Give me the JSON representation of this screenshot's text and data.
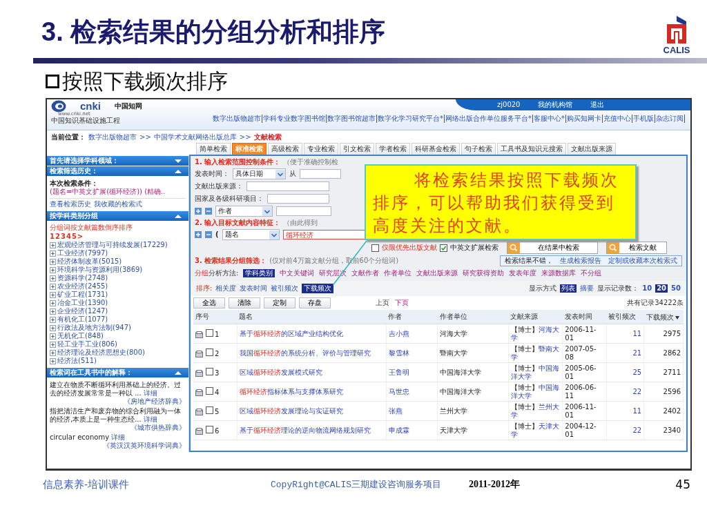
{
  "slide": {
    "title": "3. 检索结果的分组分析和排序",
    "logo_text": "CALIS",
    "subtitle": "按照下载频次排序"
  },
  "screen": {
    "header": {
      "logo": {
        "mark": "cnki",
        "name": "中国知网",
        "url": "www.cnki.net",
        "tagline": "中国知识基础设施工程"
      },
      "user_links": [
        "zj0020",
        "我的机构馆",
        "退出"
      ],
      "nav_links": [
        "数字出版物超市",
        "学科专业数字图书馆",
        "数字图书馆超市",
        "数字化学习研究平台*",
        "网络出版合作单位服务平台*",
        "客服中心*",
        "购买知网卡",
        "充值中心",
        "手机版",
        "杂志订阅"
      ]
    },
    "breadcrumb": {
      "label": "当前位置：",
      "items": [
        {
          "kind": "link",
          "text": "数字出版物超市"
        },
        {
          "kind": "separator",
          "text": ">>"
        },
        {
          "kind": "link",
          "text": "中国学术文献网络出版总库"
        },
        {
          "kind": "separator",
          "text": ">>"
        },
        {
          "kind": "current",
          "text": "文献检索"
        }
      ]
    },
    "tabs": [
      {
        "label": "简单检索",
        "selected": false
      },
      {
        "label": "标准检索",
        "selected": true
      },
      {
        "label": "高级检索",
        "selected": false
      },
      {
        "label": "专业检索",
        "selected": false
      },
      {
        "label": "引文检索",
        "selected": false
      },
      {
        "label": "学者检索",
        "selected": false
      },
      {
        "label": "科研基金检索",
        "selected": false
      },
      {
        "label": "句子检索",
        "selected": false
      },
      {
        "label": "工具书及知识元搜索",
        "selected": false
      },
      {
        "label": "文献出版来源",
        "selected": false
      }
    ],
    "sidebar": {
      "subject_panel": {
        "title": "首先请选择学科领域：",
        "expanded": false
      },
      "history_panel": {
        "title": "检索筛选历史：",
        "expanded": true,
        "condition_label": "本次检索条件：",
        "condition": "(题名=中英文扩展(循环经济)) (精确..",
        "links": [
          "查看检索历史",
          "我收藏的检索式"
        ]
      },
      "group_panel": {
        "title": "按学科类别分组",
        "expanded": true,
        "order_note": "分组词按文献篇数倒序排序",
        "pages": [
          "1",
          "2",
          "3",
          "4",
          "5",
          ">"
        ],
        "items": [
          {
            "label": "宏观经济管理与可持续发展(17229)",
            "expanded": false
          },
          {
            "label": "工业经济(7997)",
            "expanded": false
          },
          {
            "label": "经济体制改革(5015)",
            "expanded": false
          },
          {
            "label": "环境科学与资源利用(3869)",
            "expanded": false
          },
          {
            "label": "资源科学(2748)",
            "expanded": false
          },
          {
            "label": "农业经济(2455)",
            "expanded": false
          },
          {
            "label": "矿业工程(1731)",
            "expanded": false
          },
          {
            "label": "冶金工业(1390)",
            "expanded": false
          },
          {
            "label": "企业经济(1247)",
            "expanded": false
          },
          {
            "label": "有机化工(1077)",
            "expanded": false
          },
          {
            "label": "行政法及地方法制(947)",
            "expanded": false
          },
          {
            "label": "无机化工(848)",
            "expanded": false
          },
          {
            "label": "轻工业手工业(806)",
            "expanded": false
          },
          {
            "label": "经济理论及经济思想史(800)",
            "expanded": false
          },
          {
            "label": "经济法(511)",
            "expanded": false
          }
        ]
      },
      "dictionary_panel": {
        "title": "检索词在工具书中的解释：",
        "expanded": true,
        "entries": [
          {
            "text": "建立在物质不断循环利用基础上的经济。过去的经济发展常常是一种以 ...",
            "link": "详细",
            "source": "《房地产经济辞典》"
          },
          {
            "text": "指把清洁生产和废弃物的综合利用融为一体的经济,本质上是一种生态经...",
            "link": "详细",
            "source": "《城市供热辞典》"
          },
          {
            "text": "circular economy",
            "link": "详细",
            "source": "《英汉汉英环境科学词典》"
          }
        ]
      }
    },
    "search_form": {
      "step1": {
        "heading": "1. 输入检索范围控制条件：",
        "note": "（便于准确控制检"
      },
      "date_row": {
        "label": "发表时间：",
        "select": "具体日期",
        "from_label": "从"
      },
      "source_row": {
        "label": "文献出版来源："
      },
      "project_row": {
        "label": "国家及各级科研项目："
      },
      "author_row": {
        "select": "作者"
      },
      "step2": {
        "heading": "2. 输入目标文献内容特征：",
        "note": "（由此得到"
      },
      "content_row": {
        "paren": "(",
        "select": "题名",
        "value": "循环经济"
      },
      "options": [
        {
          "label": "仅限优先出版文献",
          "checked": false
        },
        {
          "label": "中英文扩展检索",
          "checked": true
        }
      ],
      "buttons": [
        "在结果中检索",
        "检索文献"
      ]
    },
    "grouping": {
      "heading": "3. 检索结果分组筛选：",
      "note": "(仅对前4万篇文献分组，取前60个分组词)",
      "feedback": {
        "text": "检索结果不错，",
        "links": [
          "生成检索报告",
          "定制或收藏本次检索式"
        ]
      },
      "method_label": {
        "highlight": "分组",
        "rest": "分析方法:"
      },
      "methods": [
        {
          "label": "学科类别",
          "selected": true
        },
        {
          "label": "中文关键词",
          "selected": false
        },
        {
          "label": "研究层次",
          "selected": false
        },
        {
          "label": "文献作者",
          "selected": false
        },
        {
          "label": "作者单位",
          "selected": false
        },
        {
          "label": "文献出版来源",
          "selected": false
        },
        {
          "label": "研究获得资助",
          "selected": false
        },
        {
          "label": "发表年度",
          "selected": false
        },
        {
          "label": "来源数据库",
          "selected": false
        },
        {
          "label": "不分组",
          "selected": false
        }
      ]
    },
    "sorting": {
      "label": "排序:",
      "options": [
        {
          "label": "相关度",
          "selected": false
        },
        {
          "label": "发表时间",
          "selected": false
        },
        {
          "label": "被引频次",
          "selected": false
        },
        {
          "label": "下载频次",
          "selected": true
        }
      ]
    },
    "display": {
      "label": "显示方式",
      "modes": [
        {
          "label": "列表",
          "selected": true
        },
        {
          "label": "摘要",
          "selected": false
        }
      ],
      "count_label": "显示记录数：",
      "counts": [
        {
          "label": "10",
          "selected": false
        },
        {
          "label": "20",
          "selected": true
        },
        {
          "label": "50",
          "selected": false
        }
      ]
    },
    "actions": [
      "全选",
      "清除",
      "定制",
      "存盘"
    ],
    "pager": [
      {
        "label": "上页",
        "disabled": true
      },
      {
        "label": "下页",
        "disabled": false
      }
    ],
    "total": "共有记录34222条",
    "results": {
      "columns": [
        {
          "label": "序号",
          "sorted": false
        },
        {
          "label": "题名",
          "sorted": false
        },
        {
          "label": "作者",
          "sorted": false
        },
        {
          "label": "作者单位",
          "sorted": false
        },
        {
          "label": "文献来源",
          "sorted": false
        },
        {
          "label": "发表时间",
          "sorted": false
        },
        {
          "label": "被引频次",
          "sorted": false
        },
        {
          "label": "下载频次",
          "sorted": true
        }
      ],
      "rows": [
        {
          "number": "1",
          "checked": false,
          "title": {
            "before": "基于",
            "keyword": "循环经济",
            "after": "的区域产业结构优化"
          },
          "author": "吉小燕",
          "unit": "河海大学",
          "source": {
            "type": "【博士】",
            "name": "河海大学"
          },
          "date": "2006-11-01",
          "cited": "11",
          "downloads": "2975"
        },
        {
          "number": "2",
          "checked": false,
          "title": {
            "before": "我国",
            "keyword": "循环经济",
            "after": "的系统分析、评价与管理研究"
          },
          "author": "黎雪林",
          "unit": "暨南大学",
          "source": {
            "type": "【博士】",
            "name": "暨南大学"
          },
          "date": "2007-05-08",
          "cited": "21",
          "downloads": "2862"
        },
        {
          "number": "3",
          "checked": false,
          "title": {
            "before": "区域",
            "keyword": "循环经济",
            "after": "发展模式研究"
          },
          "author": "王鲁明",
          "unit": "中国海洋大学",
          "source": {
            "type": "【博士】",
            "name": "中国海洋大学"
          },
          "date": "2005-06-01",
          "cited": "25",
          "downloads": "2711"
        },
        {
          "number": "4",
          "checked": false,
          "title": {
            "keyword": "循环经济",
            "after": "指标体系与支撑体系研究"
          },
          "author": "马世忠",
          "unit": "中国海洋大学",
          "source": {
            "type": "【博士】",
            "name": "中国海洋大学"
          },
          "date": "2006-06-11",
          "cited": "22",
          "downloads": "2596"
        },
        {
          "number": "5",
          "checked": false,
          "title": {
            "before": "区域",
            "keyword": "循环经济",
            "after": "发展理论与实证研究"
          },
          "author": "张燕",
          "unit": "兰州大学",
          "source": {
            "type": "【博士】",
            "name": "兰州大学"
          },
          "date": "2006-11-01",
          "cited": "11",
          "downloads": "2402"
        },
        {
          "number": "6",
          "checked": false,
          "title": {
            "before": "基于",
            "keyword": "循环经济",
            "after": "理论的逆向物流网络规划研究"
          },
          "author": "申成霖",
          "unit": "天津大学",
          "source": {
            "type": "【博士】",
            "name": "天津大学"
          },
          "date": "2004-12-01",
          "cited": "22",
          "downloads": "2340"
        }
      ]
    },
    "callout": {
      "text": "将检索结果按照下载频次排序，可以帮助我们获得受到高度关注的文献。"
    }
  },
  "footer": {
    "course": "信息素养-培训课件",
    "copyright": "CopyRight@CALIS三期建设咨询服务项目",
    "year": "2011-2012年",
    "page": "45"
  }
}
